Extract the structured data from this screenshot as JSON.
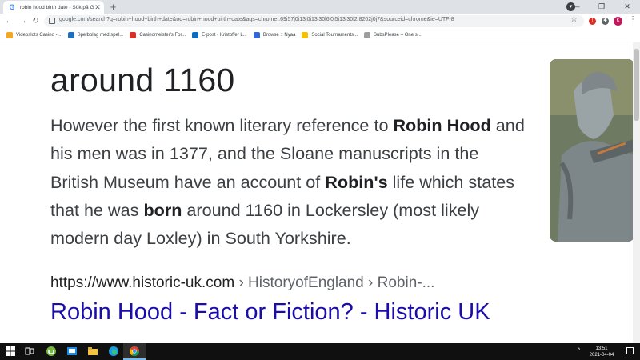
{
  "tab": {
    "title": "robin hood birth date - Sök på Google",
    "favicon": "G"
  },
  "toolbar": {
    "url": "google.com/search?q=robin+hood+birth+date&oq=robin+hood+birth+date&aqs=chrome..69i57j0i13j0i13i30l6j0i5i13i30l2.8202j0j7&sourceid=chrome&ie=UTF-8",
    "profile_initial": "K"
  },
  "bookmarks": [
    {
      "label": "Videoslots Casino -...",
      "color": "#f5a623"
    },
    {
      "label": "Spelbolag med spel...",
      "color": "#1f6fbf"
    },
    {
      "label": "Casinomeister's For...",
      "color": "#d93025"
    },
    {
      "label": "E-post - Kristoffer L...",
      "color": "#0f6cbd"
    },
    {
      "label": "Browse :: Nyaa",
      "color": "#3367d6"
    },
    {
      "label": "Social Tournaments...",
      "color": "#fbbc04"
    },
    {
      "label": "SubsPlease – One s...",
      "color": "#9e9e9e"
    }
  ],
  "result": {
    "answer": "around 1160",
    "snippet": [
      {
        "text": "However the first known literary reference to ",
        "bold": false
      },
      {
        "text": "Robin Hood",
        "bold": true
      },
      {
        "text": " and his men was in 1377, and the Sloane manuscripts in the British Museum have an account of ",
        "bold": false
      },
      {
        "text": "Robin's",
        "bold": true
      },
      {
        "text": " life which states that he was ",
        "bold": false
      },
      {
        "text": "born",
        "bold": true
      },
      {
        "text": " around 1160 in Lockersley (most likely modern day Loxley) in South Yorkshire.",
        "bold": false
      }
    ],
    "cite_domain": "https://www.historic-uk.com",
    "cite_path": " › HistoryofEngland › Robin-...",
    "link_title": "Robin Hood - Fact or Fiction? - Historic UK"
  },
  "taskbar": {
    "time": "13:51",
    "date": "2021-04-04"
  },
  "colors": {
    "link": "#1a0dab",
    "text": "#202124",
    "snippet": "#3c4043"
  }
}
